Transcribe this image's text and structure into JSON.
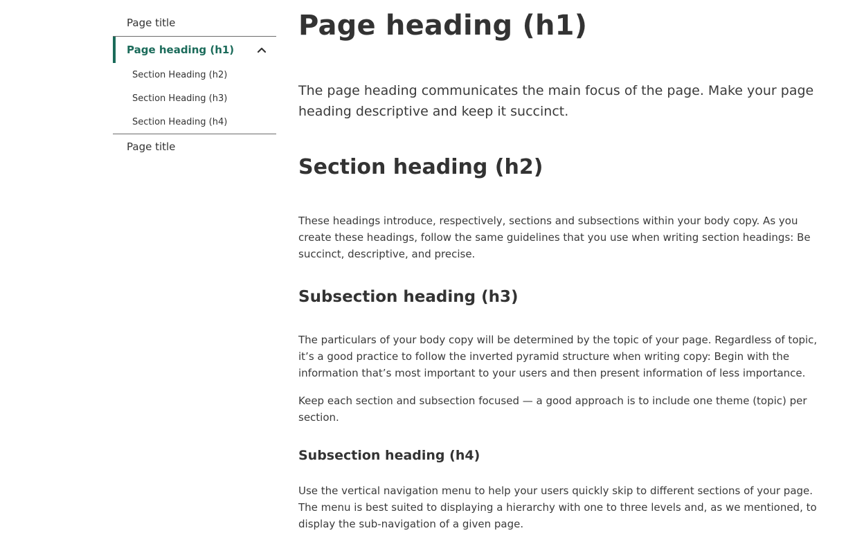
{
  "sidebar": {
    "items": [
      {
        "label": "Page title"
      },
      {
        "label": "Page heading (h1)"
      },
      {
        "label": "Page title"
      }
    ],
    "subitems": [
      {
        "label": "Section Heading (h2)"
      },
      {
        "label": "Section Heading (h3)"
      },
      {
        "label": "Section Heading (h4)"
      }
    ],
    "active_icon": "chevron-up-icon",
    "accent_color": "#1b6b5a"
  },
  "main": {
    "h1": "Page heading (h1)",
    "lead": "The page heading communicates the main focus of the page. Make your page heading descriptive and keep it succinct.",
    "h2": "Section heading (h2)",
    "p1": "These headings introduce, respectively, sections and subsections within your body copy. As you create these headings, follow the same guidelines that you use when writing section headings: Be succinct, descriptive, and precise.",
    "h3": "Subsection heading (h3)",
    "p2": "The particulars of your body copy will be determined by the topic of your page. Regardless of topic, it’s a good practice to follow the inverted pyramid structure when writing copy: Begin with the information that’s most important to your users and then present information of less importance.",
    "p3": "Keep each section and subsection focused — a good approach is to include one theme (topic) per section.",
    "h4": "Subsection heading (h4)",
    "p4": "Use the vertical navigation menu to help your users quickly skip to different sections of your page. The menu is best suited to displaying a hierarchy with one to three levels and, as we mentioned, to display the sub-navigation of a given page."
  }
}
